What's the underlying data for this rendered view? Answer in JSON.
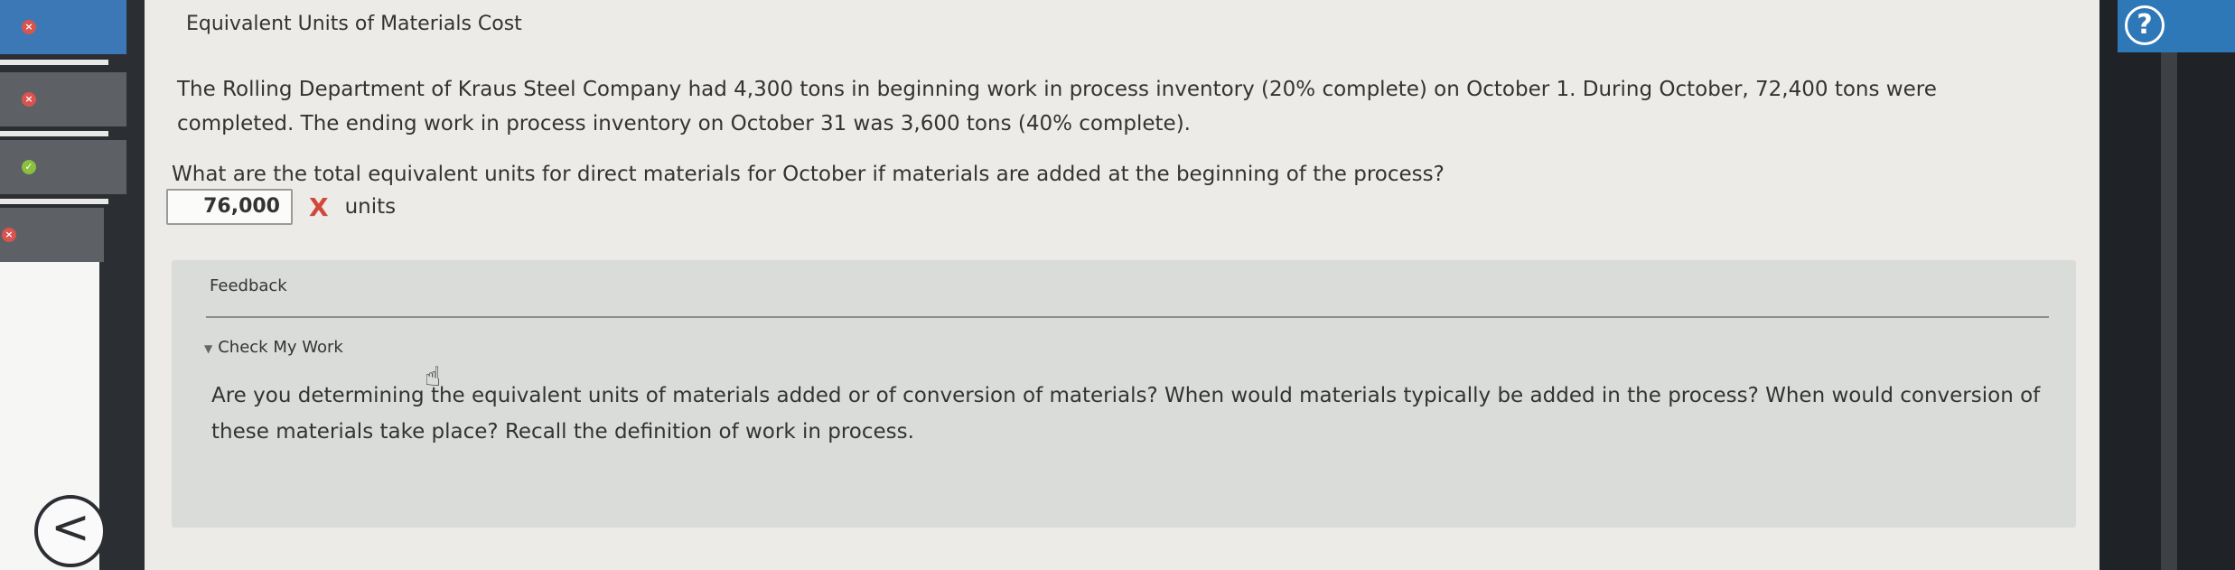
{
  "sidebar": {
    "items": [
      {
        "status": "wrong",
        "glyph": "×"
      },
      {
        "status": "wrong",
        "glyph": "×"
      },
      {
        "status": "correct",
        "glyph": "✓"
      },
      {
        "status": "wrong",
        "glyph": "×"
      }
    ],
    "back_glyph": "<"
  },
  "header": {
    "help_glyph": "?"
  },
  "problem": {
    "title": "Equivalent Units of Materials Cost",
    "paragraph": "The Rolling Department of Kraus Steel Company had 4,300 tons in beginning work in process inventory (20% complete) on October 1. During October, 72,400 tons were completed. The ending work in process inventory on October 31 was 3,600 tons (40% complete).",
    "question": "What are the total equivalent units for direct materials for October if materials are added at the beginning of the process?",
    "answer_value": "76,000",
    "answer_status_glyph": "X",
    "answer_units": "units"
  },
  "feedback": {
    "label": "Feedback",
    "check_my_work": "Check My Work",
    "text": "Are you determining the equivalent units of materials added or of conversion of materials? When would materials typically be added in the process? When would conversion of these materials take place? Recall the definition of work in process."
  },
  "colors": {
    "active_nav": "#3c78b5",
    "wrong": "#d9534f",
    "correct": "#8bbf3e",
    "incorrect_mark": "#d2473c"
  },
  "icons": [
    "wrong-status-icon",
    "correct-status-icon",
    "back-arrow-icon",
    "help-icon",
    "incorrect-x-icon",
    "disclosure-triangle-icon",
    "hand-cursor-icon"
  ]
}
